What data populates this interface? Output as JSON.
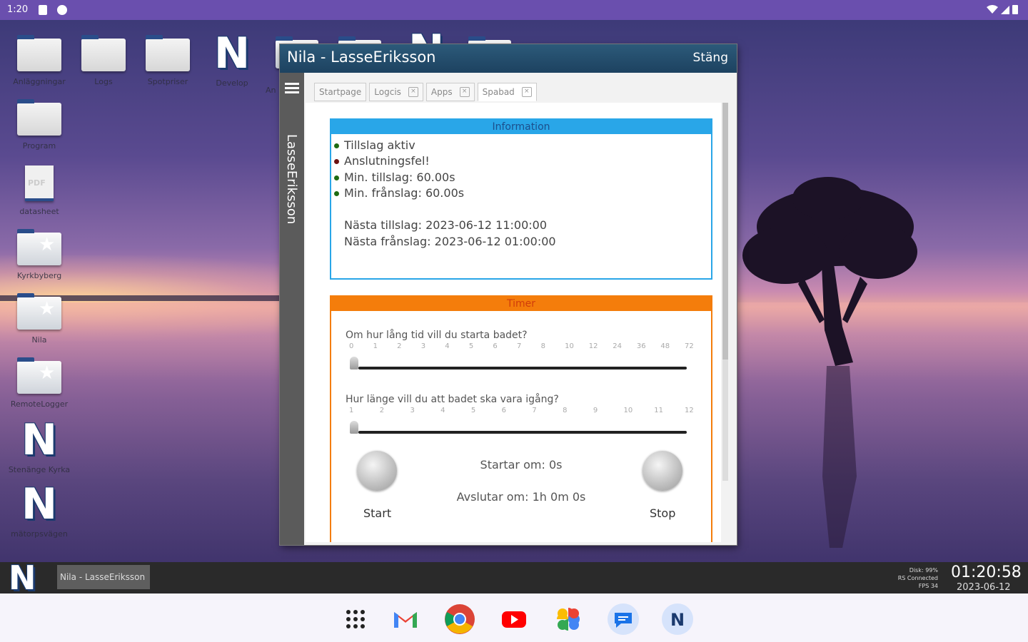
{
  "status_bar": {
    "time": "1:20"
  },
  "desktop_icons": [
    {
      "label": "Anläggningar",
      "type": "folder"
    },
    {
      "label": "Logs",
      "type": "folder"
    },
    {
      "label": "Spotpriser",
      "type": "folder"
    },
    {
      "label": "Develop",
      "type": "nila"
    },
    {
      "label": "Program",
      "type": "folder"
    },
    {
      "label": "datasheet",
      "type": "pdf",
      "pdf_text": "PDF"
    },
    {
      "label": "Kyrkbyberg",
      "type": "folder-star"
    },
    {
      "label": "Nila",
      "type": "folder-star"
    },
    {
      "label": "RemoteLogger",
      "type": "folder-star"
    },
    {
      "label": "Stenänge Kyrka",
      "type": "nila"
    },
    {
      "label": "mätorpsvägen",
      "type": "nila"
    },
    {
      "label": "An",
      "type": "partial"
    }
  ],
  "window": {
    "title": "Nila - LasseEriksson",
    "close_label": "Stäng",
    "side_user": "LasseEriksson",
    "tabs": [
      {
        "label": "Startpage",
        "closable": false
      },
      {
        "label": "Logcis",
        "closable": true
      },
      {
        "label": "Apps",
        "closable": true
      },
      {
        "label": "Spabad",
        "closable": true
      }
    ],
    "close_tab_symbol": "×"
  },
  "info_panel": {
    "title": "Information",
    "status": [
      {
        "text": "Tillslag aktiv",
        "color": "#1d6b12"
      },
      {
        "text": "Anslutningsfel!",
        "color": "#6b1111"
      },
      {
        "text": "Min. tillslag: 60.00s",
        "color": "#1d6b12"
      },
      {
        "text": "Min. frånslag: 60.00s",
        "color": "#1d6b12"
      }
    ],
    "next_on": "Nästa tillslag: 2023-06-12 11:00:00",
    "next_off": "Nästa frånslag: 2023-06-12 01:00:00"
  },
  "timer_panel": {
    "title": "Timer",
    "q1": "Om hur lång tid vill du starta badet?",
    "q1_ticks": [
      "0",
      "1",
      "2",
      "3",
      "4",
      "5",
      "6",
      "7",
      "8",
      "10",
      "12",
      "24",
      "36",
      "48",
      "72"
    ],
    "q1_value": "0",
    "q2": "Hur länge vill du att badet ska vara igång?",
    "q2_ticks": [
      "1",
      "2",
      "3",
      "4",
      "5",
      "6",
      "7",
      "8",
      "9",
      "10",
      "11",
      "12"
    ],
    "q2_value": "1",
    "start_label": "Start",
    "stop_label": "Stop",
    "starts_in": "Startar om: 0s",
    "ends_in": "Avslutar om: 1h 0m 0s"
  },
  "taskbar": {
    "logo": "N",
    "item": "Nila - LasseEriksson",
    "stats": [
      "Disk: 99%",
      "RS Connected",
      "FPS 34"
    ],
    "time": "01:20:58",
    "date": "2023-06-12"
  },
  "dock": {
    "apps": [
      "app-drawer",
      "gmail",
      "chrome",
      "youtube",
      "photos",
      "messages",
      "nila"
    ]
  }
}
